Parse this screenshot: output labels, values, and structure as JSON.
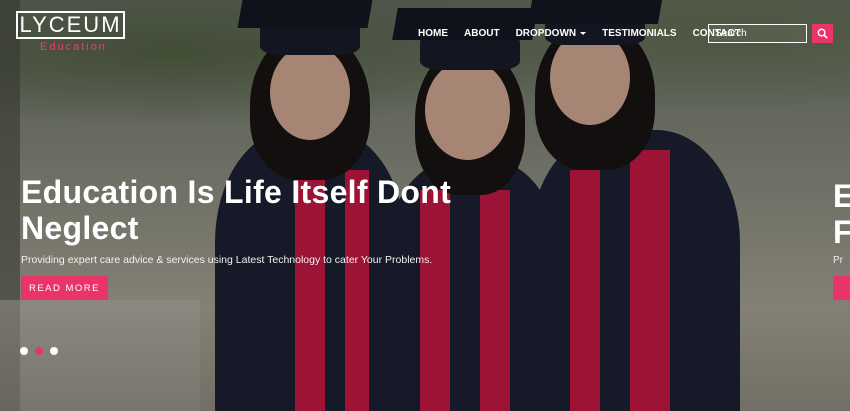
{
  "brand": {
    "name": "LYCEUM",
    "sub": "Education"
  },
  "nav": {
    "items": [
      {
        "label": "HOME"
      },
      {
        "label": "ABOUT"
      },
      {
        "label": "DROPDOWN"
      },
      {
        "label": "TESTIMONIALS"
      },
      {
        "label": "CONTACT"
      }
    ]
  },
  "search": {
    "placeholder": "Search"
  },
  "slide": {
    "headline": "Education Is Life Itself Dont Neglect",
    "tagline": "Providing expert care advice & services using Latest Technology to cater Your Problems.",
    "cta": "READ MORE"
  },
  "next_slide": {
    "peek_headline": "E\nF",
    "peek_tagline": "Pr"
  },
  "colors": {
    "accent": "#e8336b",
    "gown": "#1f2336",
    "stole": "#d81b4a"
  },
  "carousel": {
    "slide_count": 3,
    "active_index": 1
  }
}
